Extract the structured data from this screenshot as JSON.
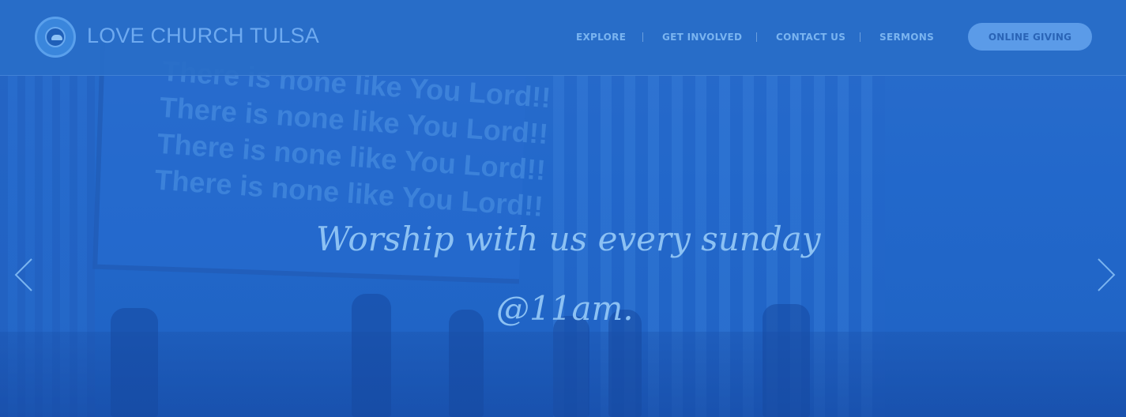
{
  "header": {
    "site_title": "LOVE CHURCH TULSA",
    "logo_icon": "church-seal-logo-icon"
  },
  "nav": {
    "items": [
      {
        "label": "EXPLORE"
      },
      {
        "label": "GET INVOLVED"
      },
      {
        "label": "CONTACT US"
      },
      {
        "label": "SERMONS"
      }
    ],
    "cta_label": "ONLINE GIVING"
  },
  "hero": {
    "headline_line1": "Worship with us every sunday",
    "headline_line2": "@11am.",
    "background_lyrics": [
      "There is none like You Lord!!",
      "There is none like You Lord!!",
      "There is none like You Lord!!",
      "There is none like You Lord!!"
    ],
    "prev_icon": "chevron-left-icon",
    "next_icon": "chevron-right-icon"
  },
  "colors": {
    "overlay": "#2369c8",
    "nav_text": "#7ab4f0",
    "button_bg": "#5b9be8",
    "headline": "#8cc1f3"
  }
}
